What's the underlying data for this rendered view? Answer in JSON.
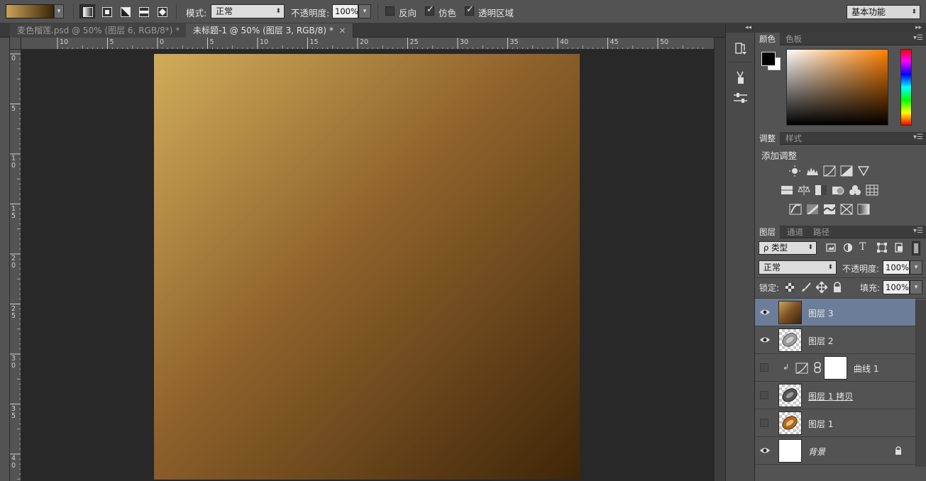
{
  "optionbar": {
    "gradient_start": "#c9a45a",
    "gradient_end": "#3d2508",
    "mode_label": "模式:",
    "mode_value": "正常",
    "opacity_label": "不透明度:",
    "opacity_value": "100%",
    "reverse_label": "反向",
    "reverse_checked": false,
    "dither_label": "仿色",
    "dither_checked": true,
    "transparency_label": "透明区域",
    "transparency_checked": true,
    "workspace_value": "基本功能"
  },
  "tabs": [
    {
      "label": "麦色榴莲.psd @ 50% (图层 6, RGB/8*) *",
      "active": false
    },
    {
      "label": "未标题-1 @ 50% (图层 3, RGB/8) *",
      "active": true
    }
  ],
  "rulers": {
    "h_labels": [
      "10",
      "5",
      "0",
      "5",
      "10",
      "15",
      "20",
      "25",
      "30",
      "35",
      "40",
      "45",
      "50"
    ],
    "v_labels": [
      "0",
      "5",
      "10",
      "15",
      "20",
      "25",
      "30",
      "35",
      "40"
    ]
  },
  "canvas": {
    "gradient_colors": [
      "#d0ac5a",
      "#8f622b",
      "#3f2609"
    ]
  },
  "color_panel": {
    "tabs": [
      "颜色",
      "色板"
    ],
    "foreground": "#000000",
    "background": "#ffffff"
  },
  "adjust_panel": {
    "tabs": [
      "调整",
      "样式"
    ],
    "title": "添加调整"
  },
  "layers_panel": {
    "tabs": [
      "图层",
      "通道",
      "路径"
    ],
    "filter_label": "ρ 类型",
    "blend_mode": "正常",
    "opacity_label": "不透明度:",
    "opacity_value": "100%",
    "lock_label": "锁定:",
    "fill_label": "填充:",
    "fill_value": "100%",
    "layers": [
      {
        "name": "图层 3",
        "visible": true,
        "selected": true,
        "thumb": "gradient"
      },
      {
        "name": "图层 2",
        "visible": true,
        "selected": false,
        "thumb": "object-gray"
      },
      {
        "name": "曲线 1",
        "visible": false,
        "selected": false,
        "thumb": "mask"
      },
      {
        "name": "图层 1 拷贝",
        "visible": false,
        "selected": false,
        "thumb": "object-dark"
      },
      {
        "name": "图层 1",
        "visible": false,
        "selected": false,
        "thumb": "object-orange"
      },
      {
        "name": "背景",
        "visible": true,
        "selected": false,
        "thumb": "white"
      }
    ]
  }
}
